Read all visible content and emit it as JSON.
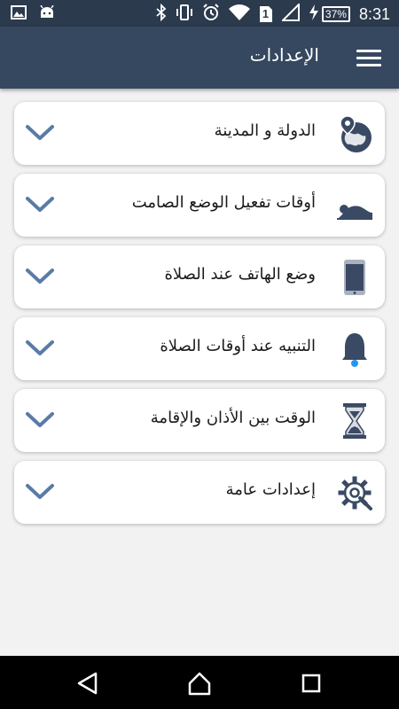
{
  "status_bar": {
    "time": "8:31",
    "battery": "37%",
    "sim": "1",
    "left_icons": [
      "image-icon",
      "android-icon"
    ],
    "right_icons": [
      "bluetooth-icon",
      "vibrate-icon",
      "alarm-icon",
      "wifi-icon",
      "sim-icon",
      "signal-icon",
      "charging-icon",
      "battery-icon"
    ]
  },
  "app_bar": {
    "title": "الإعدادات",
    "menu_icon": "hamburger-menu-icon"
  },
  "settings": [
    {
      "label": "الدولة و المدينة",
      "icon": "globe-location-icon"
    },
    {
      "label": "أوقات تفعيل الوضع الصامت",
      "icon": "prostration-icon"
    },
    {
      "label": "وضع الهاتف عند الصلاة",
      "icon": "phone-icon"
    },
    {
      "label": "التنبيه عند أوقات الصلاة",
      "icon": "bell-icon"
    },
    {
      "label": "الوقت بين الأذان والإقامة",
      "icon": "hourglass-icon"
    },
    {
      "label": "إعدادات عامة",
      "icon": "gear-wrench-icon"
    }
  ],
  "colors": {
    "status_bar": "#2b3a4d",
    "app_bar": "#354860",
    "background": "#f2f2f2",
    "chevron": "#5a7ba8",
    "icon": "#3a4a64"
  },
  "nav_bar": [
    "back-icon",
    "home-icon",
    "recents-icon"
  ]
}
